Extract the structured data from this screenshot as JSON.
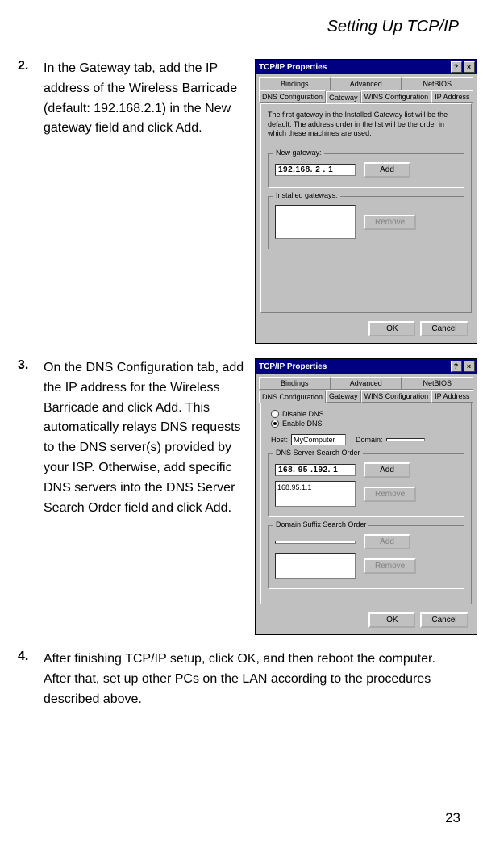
{
  "header": {
    "title": "Setting Up TCP/IP"
  },
  "steps": {
    "s2": {
      "num": "2.",
      "text": "In the Gateway tab, add the IP address of the Wireless Barricade (default: 192.168.2.1) in the New gateway field and click Add."
    },
    "s3": {
      "num": "3.",
      "text": "On the DNS Configuration tab, add the IP address for the Wireless Barricade and click Add. This automatically relays DNS requests to the DNS server(s) provided by your ISP. Otherwise, add specific DNS servers into the DNS Server Search Order field and click Add."
    },
    "s4": {
      "num": "4.",
      "text": "After finishing TCP/IP setup, click OK, and then reboot the computer. After that, set up other PCs on the LAN according to the procedures described above."
    }
  },
  "dialog1": {
    "title": "TCP/IP Properties",
    "tabs_row1": [
      "Bindings",
      "Advanced",
      "NetBIOS"
    ],
    "tabs_row2": [
      "DNS Configuration",
      "Gateway",
      "WINS Configuration",
      "IP Address"
    ],
    "hint": "The first gateway in the Installed Gateway list will be the default. The address order in the list will be the order in which these machines are used.",
    "new_gw_label": "New gateway:",
    "new_gw_value": "192.168. 2 . 1",
    "add_label": "Add",
    "installed_label": "Installed gateways:",
    "remove_label": "Remove",
    "ok": "OK",
    "cancel": "Cancel"
  },
  "dialog2": {
    "title": "TCP/IP Properties",
    "tabs_row1": [
      "Bindings",
      "Advanced",
      "NetBIOS"
    ],
    "tabs_row2": [
      "DNS Configuration",
      "Gateway",
      "WINS Configuration",
      "IP Address"
    ],
    "disable_dns": "Disable DNS",
    "enable_dns": "Enable DNS",
    "host_label": "Host:",
    "host_value": "MyComputer",
    "domain_label": "Domain:",
    "domain_value": "",
    "dns_order_label": "DNS Server Search Order",
    "dns_ip": "168. 95 .192. 1",
    "dns_list_item": "168.95.1.1",
    "suffix_label": "Domain Suffix Search Order",
    "add_label": "Add",
    "remove_label": "Remove",
    "ok": "OK",
    "cancel": "Cancel"
  },
  "page_number": "23"
}
